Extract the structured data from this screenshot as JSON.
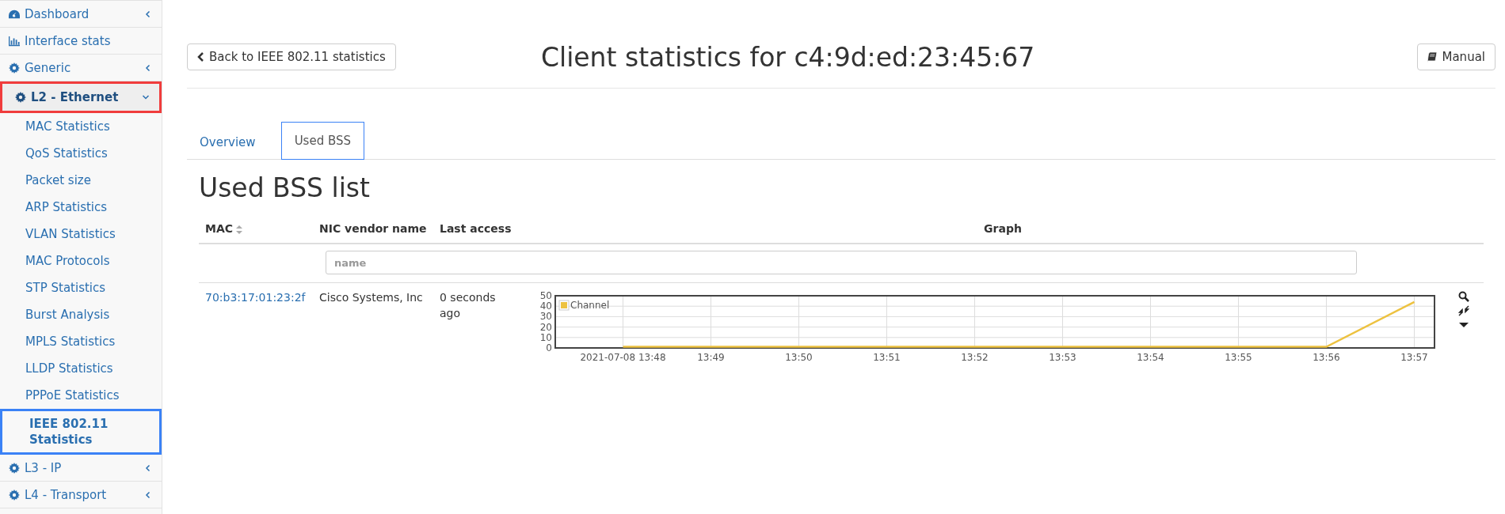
{
  "sidebar": {
    "items": [
      {
        "label": "Dashboard",
        "kind": "dashboard",
        "expanded": false
      },
      {
        "label": "Interface stats",
        "kind": "stats"
      },
      {
        "label": "Generic",
        "kind": "group",
        "expanded": false
      },
      {
        "label": "L2 - Ethernet",
        "kind": "group",
        "expanded": true,
        "color": "#f03c3c",
        "children": [
          {
            "label": "MAC Statistics",
            "selected": false
          },
          {
            "label": "QoS Statistics",
            "selected": false
          },
          {
            "label": "Packet size",
            "selected": false
          },
          {
            "label": "ARP Statistics",
            "selected": false
          },
          {
            "label": "VLAN Statistics",
            "selected": false
          },
          {
            "label": "MAC Protocols",
            "selected": false
          },
          {
            "label": "STP Statistics",
            "selected": false
          },
          {
            "label": "Burst Analysis",
            "selected": false
          },
          {
            "label": "MPLS Statistics",
            "selected": false
          },
          {
            "label": "LLDP Statistics",
            "selected": false
          },
          {
            "label": "PPPoE Statistics",
            "selected": false
          },
          {
            "label": "IEEE 802.11 Statistics",
            "selected": true,
            "color": "#3b82f6"
          }
        ]
      },
      {
        "label": "L3 - IP",
        "kind": "group",
        "expanded": false
      },
      {
        "label": "L4 - Transport",
        "kind": "group",
        "expanded": false
      }
    ]
  },
  "header": {
    "back_button": "Back to IEEE 802.11 statistics",
    "title": "Client statistics for c4:9d:ed:23:45:67",
    "manual_button": "Manual"
  },
  "tabs": [
    {
      "label": "Overview",
      "selected": false
    },
    {
      "label": "Used BSS",
      "selected": true,
      "color": "#3b82f6"
    }
  ],
  "section_title": "Used BSS list",
  "table": {
    "columns": [
      "MAC",
      "NIC vendor name",
      "Last access",
      "Graph"
    ],
    "filter": {
      "placeholder": "name"
    },
    "rows": [
      {
        "mac": "70:b3:17:01:23:2f",
        "vendor": "Cisco Systems, Inc",
        "last_access": "0 seconds ago",
        "chart_data": {
          "type": "line",
          "categories": [
            "2021-07-08 13:48",
            "13:49",
            "13:50",
            "13:51",
            "13:52",
            "13:53",
            "13:54",
            "13:55",
            "13:56",
            "13:57"
          ],
          "series": [
            {
              "name": "Channel",
              "color": "#edc240",
              "values": [
                0,
                0,
                0,
                0,
                0,
                0,
                0,
                0,
                0,
                44
              ]
            }
          ],
          "grid": true,
          "ylim": [
            0,
            50
          ],
          "yticks": [
            0,
            10,
            20,
            30,
            40,
            50
          ]
        }
      }
    ]
  }
}
